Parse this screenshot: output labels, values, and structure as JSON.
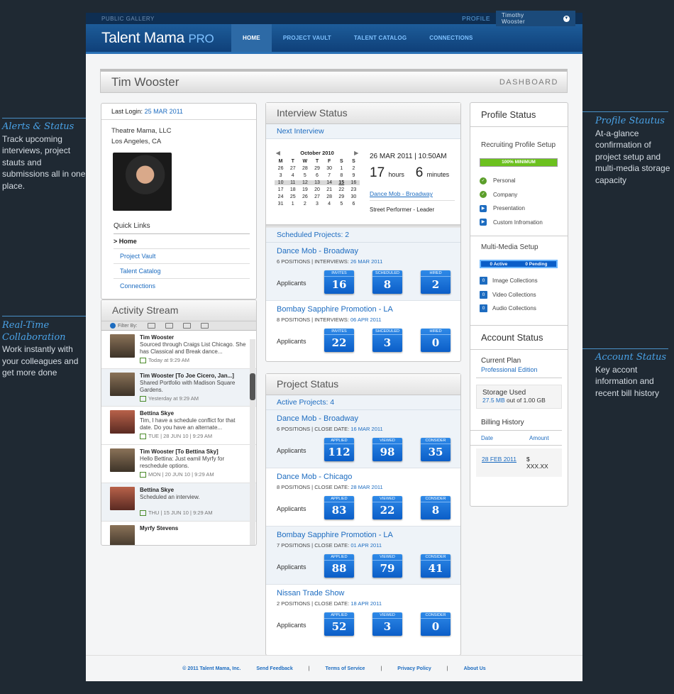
{
  "annotations": {
    "alerts": {
      "title": "Alerts & Status",
      "text": "Track upcoming interviews, project stauts and submissions all in one place."
    },
    "realtime": {
      "title": "Real-Time Collaboration",
      "text": "Work instantly with your colleagues and get more done"
    },
    "profile": {
      "title": "Profile Stautus",
      "text": "At-a-glance confirmation of project setup and multi-media storage capacity"
    },
    "account": {
      "title": "Account Status",
      "text": "Key accont information and recent bill history"
    }
  },
  "topbar": {
    "public_gallery": "PUBLIC GALLERY",
    "profile": "PROFILE",
    "user": "Timothy Wooster",
    "caret": "▼"
  },
  "header": {
    "logo": "Talent Mama",
    "logo_pro": "PRO",
    "nav": [
      "HOME",
      "PROJECT VAULT",
      "TALENT CATALOG",
      "CONNECTIONS"
    ]
  },
  "namebar": {
    "name": "Tim Wooster",
    "section": "DASHBOARD"
  },
  "left": {
    "last_login_label": "Last Login:",
    "last_login": "25 MAR 2011",
    "company": "Theatre Mama, LLC",
    "location": "Los Angeles, CA",
    "quick_links_title": "Quick Links",
    "quick_links": [
      ">  Home",
      "Project Vault",
      "Talent Catalog",
      "Connections"
    ]
  },
  "activity": {
    "title": "Activity Stream",
    "filter_label": "Filter By:",
    "items": [
      {
        "who": "Tim Wooster",
        "text": "Sourced through Craigs List Chicago. She has Classical and Break dance...",
        "when": "Today at 9:29 AM"
      },
      {
        "who": "Tim Wooster [To Joe Cicero, Jan...]",
        "text": "Shared Portfolio with Madison Square Gardens.",
        "when": "Yesterday at 9:29 AM"
      },
      {
        "who": "Bettina Skye",
        "text": "Tim, I have a schedule conflict for that date. Do you have an alternate...",
        "when": "TUE | 28 JUN 10 | 9:29 AM"
      },
      {
        "who": "Tim Wooster [To Bettina Sky]",
        "text": "Hello Bettina: Just eamil Myrfy for reschedule options.",
        "when": "MON | 20 JUN 10 | 9:29 AM"
      },
      {
        "who": "Bettina Skye",
        "text": "Scheduled an interview.",
        "when": "THU | 15 JUN 10 | 9:29 AM"
      },
      {
        "who": "Myrfy Stevens",
        "text": "",
        "when": ""
      }
    ]
  },
  "interview": {
    "title": "Interview Status",
    "next_label": "Next Interview",
    "calendar": {
      "month": "October 2010",
      "prev": "◀",
      "next": "▶",
      "days": [
        "M",
        "T",
        "W",
        "T",
        "F",
        "S",
        "S"
      ],
      "weeks": [
        [
          "26",
          "27",
          "28",
          "29",
          "30",
          "1",
          "2"
        ],
        [
          "3",
          "4",
          "5",
          "6",
          "7",
          "8",
          "9"
        ],
        [
          "10",
          "11",
          "12",
          "13",
          "14",
          "15",
          "16"
        ],
        [
          "17",
          "18",
          "19",
          "20",
          "21",
          "22",
          "23"
        ],
        [
          "24",
          "25",
          "26",
          "27",
          "28",
          "29",
          "30"
        ],
        [
          "31",
          "1",
          "2",
          "3",
          "4",
          "5",
          "6"
        ]
      ]
    },
    "date": "26 MAR 2011  |  10:50AM",
    "hours": "17",
    "hours_label": "hours",
    "minutes": "6",
    "minutes_label": "minutes",
    "project_link": "Dance Mob - Broadway",
    "role": "Street Performer - Leader",
    "scheduled_label": "Scheduled Projects: 2",
    "projects": [
      {
        "name": "Dance Mob - Broadway",
        "meta": "6 POSITIONS | INTERVIEWS:",
        "date": "26 MAR 2011",
        "applicants": "Applicants",
        "stats": [
          {
            "label": "INVITES",
            "value": "16"
          },
          {
            "label": "SCHEDULED",
            "value": "8"
          },
          {
            "label": "HIRED",
            "value": "2"
          }
        ]
      },
      {
        "name": "Bombay Sapphire Promotion - LA",
        "meta": "8 POSITIONS | INTERVIEWS:",
        "date": "06 APR 2011",
        "applicants": "Applicants",
        "stats": [
          {
            "label": "INVITES",
            "value": "22"
          },
          {
            "label": "SHCEDULED",
            "value": "3"
          },
          {
            "label": "HIRED",
            "value": "0"
          }
        ]
      }
    ]
  },
  "project_status": {
    "title": "Project Status",
    "active_label": "Active Projects: 4",
    "projects": [
      {
        "name": "Dance Mob - Broadway",
        "meta": "6 POSITIONS | CLOSE DATE:",
        "date": "16 MAR 2011",
        "applicants": "Applicants",
        "stats": [
          {
            "label": "APPLIED",
            "value": "112"
          },
          {
            "label": "VIEWED",
            "value": "98"
          },
          {
            "label": "CONSIDER",
            "value": "35"
          }
        ]
      },
      {
        "name": "Dance Mob - Chicago",
        "meta": "8 POSITIONS | CLOSE DATE:",
        "date": "28  MAR 2011",
        "applicants": "Applicants",
        "stats": [
          {
            "label": "APPLIED",
            "value": "83"
          },
          {
            "label": "VIEWED",
            "value": "22"
          },
          {
            "label": "CONSIDER",
            "value": "8"
          }
        ]
      },
      {
        "name": "Bombay Sapphire Promotion - LA",
        "meta": "7 POSITIONS | CLOSE DATE:",
        "date": "01 APR 2011",
        "applicants": "Applicants",
        "stats": [
          {
            "label": "APPLIED",
            "value": "88"
          },
          {
            "label": "VIEWED",
            "value": "79"
          },
          {
            "label": "CONSIDER",
            "value": "41"
          }
        ]
      },
      {
        "name": "Nissan Trade Show",
        "meta": "2 POSITIONS | CLOSE DATE:",
        "date": "18 APR 2011",
        "applicants": "Applicants",
        "stats": [
          {
            "label": "APPLIED",
            "value": "52"
          },
          {
            "label": "VIEWED",
            "value": "3"
          },
          {
            "label": "CONSIDER",
            "value": "0"
          }
        ]
      }
    ]
  },
  "profile_status": {
    "title": "Profile Status",
    "setup_label": "Recruiting Profile Setup",
    "progress": "100% MINIMUM",
    "progress_value": 1.0,
    "checks": [
      {
        "label": "Personal",
        "icon": "check-icon",
        "glyph": "✓"
      },
      {
        "label": "Company",
        "icon": "check-icon",
        "glyph": "✓"
      },
      {
        "label": "Presentation",
        "icon": "arrow-icon",
        "glyph": "▶"
      },
      {
        "label": "Custom Infromation",
        "icon": "arrow-icon",
        "glyph": "▶"
      }
    ],
    "mm_label": "Multi-Media Setup",
    "mm_active": "0 Active",
    "mm_pending": "0 Pending",
    "mm_rows": [
      {
        "n": "0",
        "label": "Image Collections"
      },
      {
        "n": "0",
        "label": "Video Collections"
      },
      {
        "n": "0",
        "label": "Audio Collections"
      }
    ]
  },
  "account": {
    "title": "Account Status",
    "plan_label": "Current Plan",
    "plan": "Professional Edition",
    "storage_label": "Storage Used",
    "storage_used": "27.5 MB",
    "storage_total": " out of 1.00 GB",
    "billing_title": "Billing History",
    "col_date": "Date",
    "col_amount": "Amount",
    "bill_date": "28 FEB 2011",
    "bill_amount": "$ XXX.XX"
  },
  "footer": {
    "copyright": "© 2011 Talent Mama, Inc.",
    "links": [
      "Send Feedback",
      "Terms of Service",
      "Privacy Policy",
      "About Us"
    ],
    "sep": "|"
  }
}
